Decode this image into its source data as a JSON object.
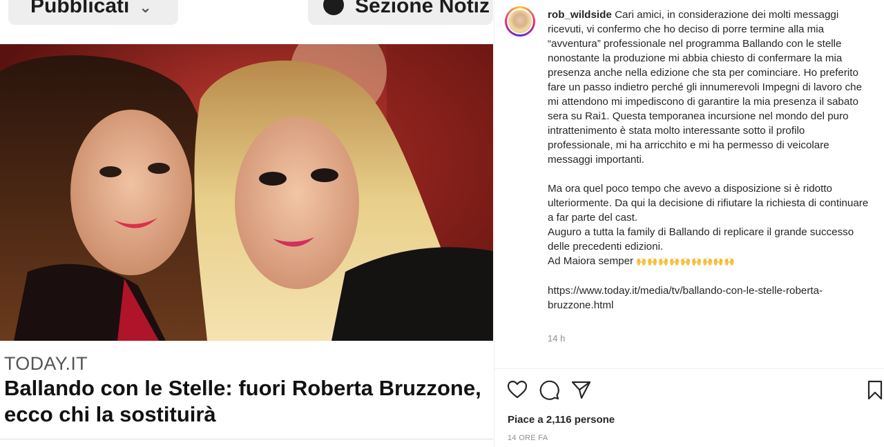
{
  "article": {
    "top_pill_left_label": "Pubblicati",
    "top_pill_right_label": "Sezione Notiz",
    "source": "TODAY.IT",
    "headline": "Ballando con le Stelle: fuori Roberta Bruzzone, ecco chi la sostituirà"
  },
  "post": {
    "username": "rob_wildside",
    "caption_first": "Cari amici, in considerazione dei molti messaggi ricevuti, vi confermo che ho deciso di porre termine alla mia “avventura” professionale nel programma Ballando con le stelle nonostante la produzione mi abbia chiesto di confermare la mia presenza anche nella edizione che sta per cominciare. Ho preferito fare un passo indietro perché gli innumerevoli Impegni di lavoro che mi attendono mi impediscono di garantire la mia presenza il sabato sera su Rai1. Questa temporanea incursione nel mondo del puro intrattenimento è stata molto interessante sotto il profilo professionale, mi ha arricchito e mi ha permesso di veicolare messaggi importanti.",
    "caption_p2_l1": "Ma ora quel poco tempo che avevo a disposizione si è ridotto ulteriormente. Da qui la decisione di rifiutare la richiesta di continuare a far parte del cast.",
    "caption_p2_l2": "Auguro a tutta la family di Ballando di replicare il grande successo delle precedenti edizioni.",
    "caption_p2_l3": "Ad Maiora semper",
    "caption_emojis": "🙌🙌🙌🙌🙌🙌🙌🙌🙌",
    "caption_link": "https://www.today.it/media/tv/ballando-con-le-stelle-roberta-bruzzone.html",
    "comment_time": "14 h",
    "likes": "Piace a 2,116 persone",
    "post_time": "14 ORE FA"
  },
  "icons": {
    "like": "heart-icon",
    "comment": "comment-bubble-icon",
    "share": "paper-plane-icon",
    "save": "bookmark-icon"
  }
}
